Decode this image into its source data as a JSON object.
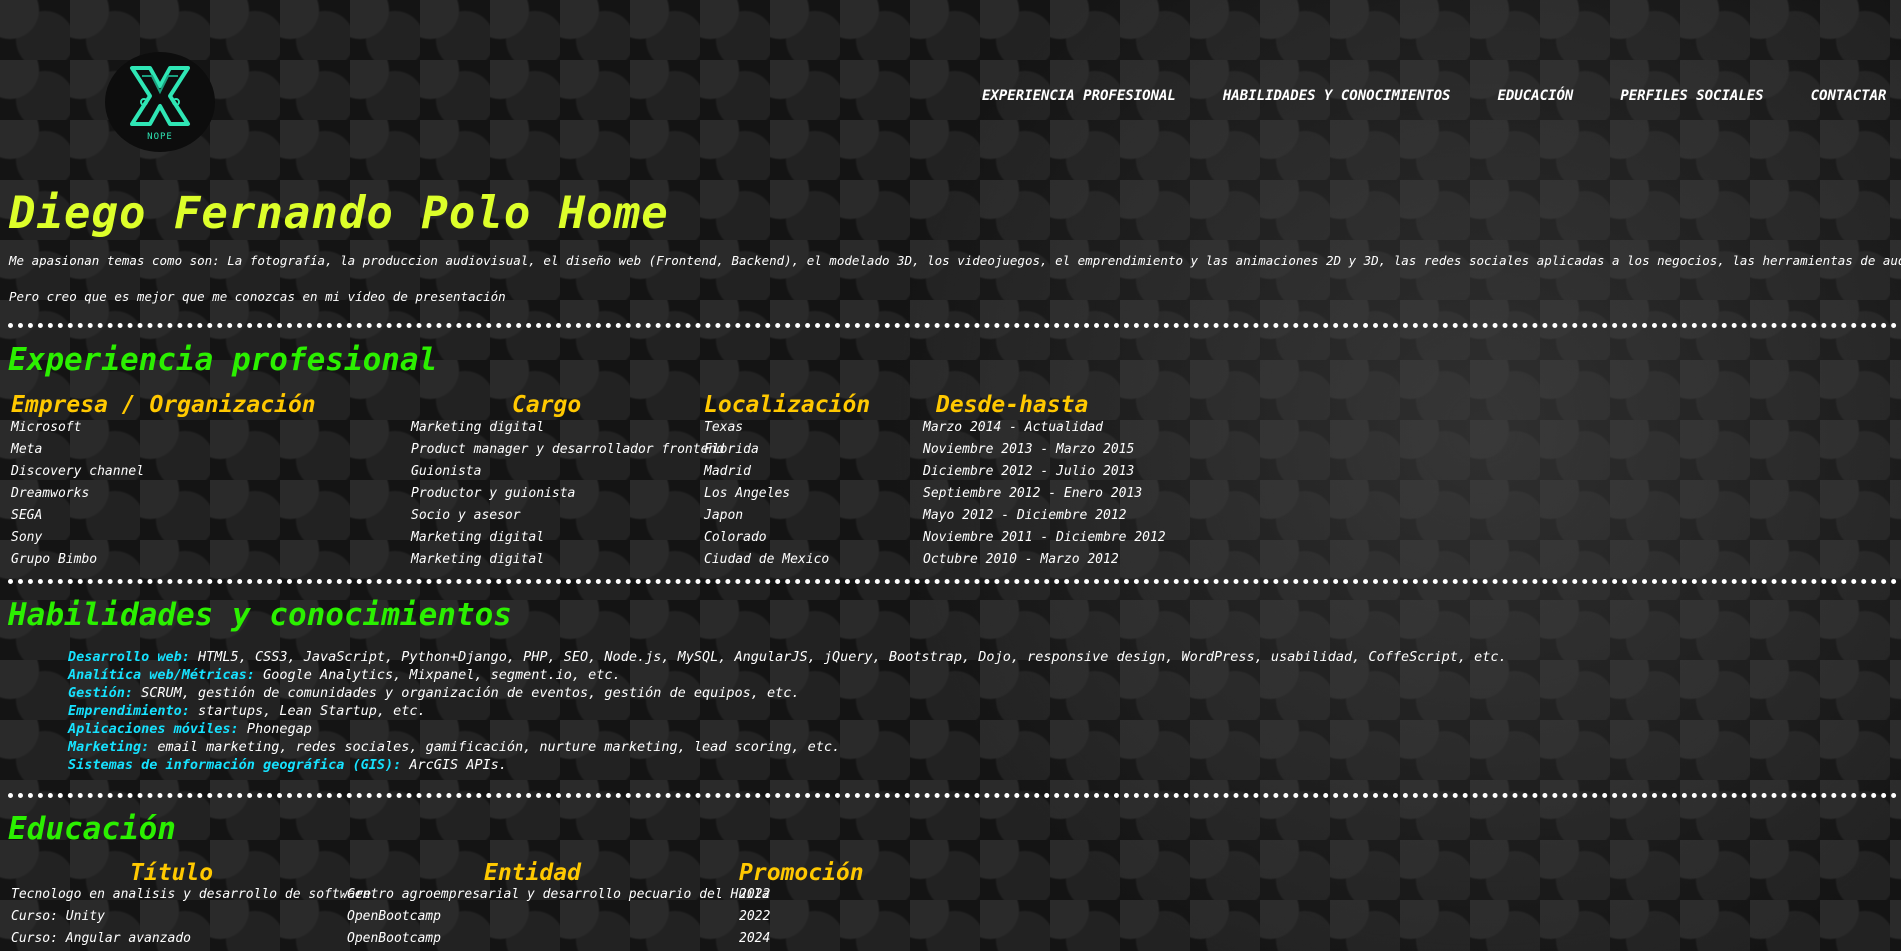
{
  "logo": {
    "text": "NOPE"
  },
  "nav": {
    "items": [
      {
        "label": "EXPERIENCIA PROFESIONAL"
      },
      {
        "label": "HABILIDADES Y CONOCIMIENTOS"
      },
      {
        "label": "EDUCACIÓN"
      },
      {
        "label": "PERFILES SOCIALES"
      },
      {
        "label": "CONTACTAR"
      }
    ]
  },
  "hero": {
    "title": "Diego Fernando Polo Home",
    "intro": "Me apasionan temas como son: La fotografía, la produccion audiovisual, el diseño web (Frontend, Backend), el modelado 3D, los videojuegos, el emprendimiento y las animaciones 2D y 3D, las redes sociales aplicadas a los negocios, las herramientas de audio, etc.",
    "video_text": "Pero creo que es mejor que me conozcas en mi vídeo de presentación"
  },
  "experience": {
    "heading": "Experiencia profesional",
    "columns": [
      "Empresa / Organización",
      "Cargo",
      "Localización",
      "Desde-hasta"
    ],
    "rows": [
      [
        "Microsoft",
        "Marketing digital",
        "Texas",
        "Marzo 2014 - Actualidad"
      ],
      [
        "Meta",
        "Product manager y desarrollador frontend",
        "Florida",
        "Noviembre 2013 - Marzo 2015"
      ],
      [
        "Discovery channel",
        "Guionista",
        "Madrid",
        "Diciembre 2012 - Julio 2013"
      ],
      [
        "Dreamworks",
        "Productor y guionista",
        "Los Angeles",
        "Septiembre 2012 - Enero 2013"
      ],
      [
        "SEGA",
        "Socio y asesor",
        "Japon",
        "Mayo 2012 - Diciembre 2012"
      ],
      [
        "Sony",
        "Marketing digital",
        "Colorado",
        "Noviembre 2011 - Diciembre 2012"
      ],
      [
        "Grupo Bimbo",
        "Marketing digital",
        "Ciudad de Mexico",
        "Octubre 2010 - Marzo 2012"
      ]
    ]
  },
  "skills": {
    "heading": "Habilidades y conocimientos",
    "items": [
      {
        "key": "Desarrollo web:",
        "value": " HTML5, CSS3, JavaScript, Python+Django, PHP, SEO, Node.js, MySQL, AngularJS, jQuery, Bootstrap, Dojo, responsive design, WordPress, usabilidad, CoffeScript, etc."
      },
      {
        "key": "Analítica web/Métricas:",
        "value": " Google Analytics, Mixpanel, segment.io, etc."
      },
      {
        "key": "Gestión:",
        "value": " SCRUM, gestión de comunidades y organización de eventos, gestión de equipos, etc."
      },
      {
        "key": "Emprendimiento:",
        "value": " startups, Lean Startup, etc."
      },
      {
        "key": "Aplicaciones móviles:",
        "value": " Phonegap"
      },
      {
        "key": "Marketing:",
        "value": " email marketing, redes sociales, gamificación, nurture marketing, lead scoring, etc."
      },
      {
        "key": "Sistemas de información geográfica (GIS):",
        "value": " ArcGIS APIs."
      }
    ]
  },
  "education": {
    "heading": "Educación",
    "columns": [
      "Título",
      "Entidad",
      "Promoción"
    ],
    "rows": [
      [
        "Tecnologo en analisis y desarrollo de software",
        "Centro agroempresarial y desarrollo pecuario del Huila",
        "2022"
      ],
      [
        "Curso: Unity",
        "OpenBootcamp",
        "2022"
      ],
      [
        "Curso: Angular avanzado",
        "OpenBootcamp",
        "2024"
      ]
    ]
  },
  "colors": {
    "title": "#ddff2a",
    "section_heading": "#2bf000",
    "column_heading": "#ffc800",
    "skill_key": "#16e2ff",
    "logo_accent": "#2fe6b5"
  }
}
